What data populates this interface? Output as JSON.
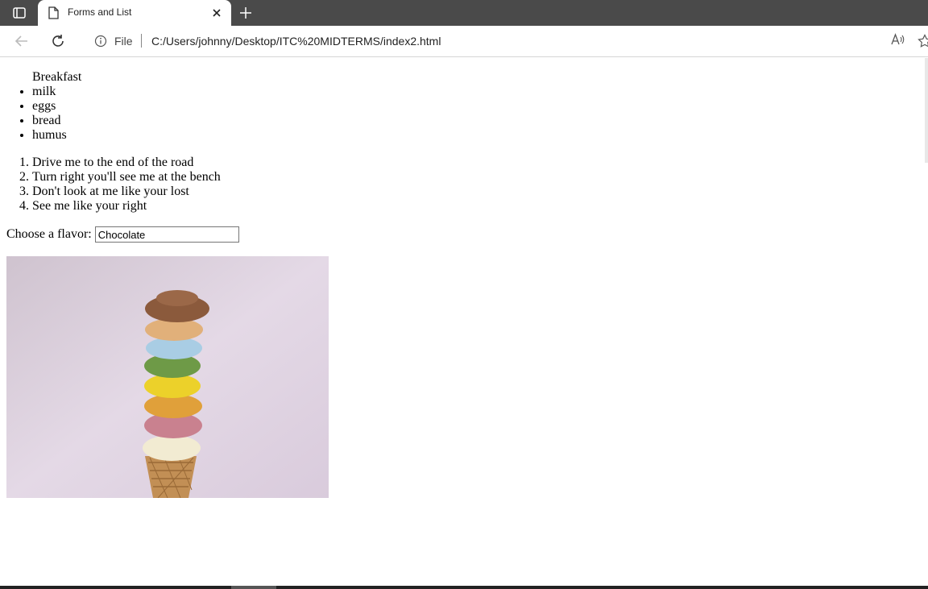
{
  "browser": {
    "tab": {
      "title": "Forms and List"
    },
    "address": {
      "site_label": "File",
      "url": "C:/Users/johnny/Desktop/ITC%20MIDTERMS/index2.html"
    }
  },
  "page": {
    "unordered_list": {
      "heading": "Breakfast",
      "items": [
        "milk",
        "eggs",
        "bread",
        "humus"
      ]
    },
    "ordered_list": {
      "items": [
        "Drive me to the end of the road",
        "Turn right you'll see me at the bench",
        "Don't look at me like your lost",
        "See me like your right"
      ]
    },
    "flavor_form": {
      "label": "Choose a flavor:",
      "value": "Chocolate"
    },
    "image": {
      "subject": "stacked-ice-cream-cone"
    }
  }
}
